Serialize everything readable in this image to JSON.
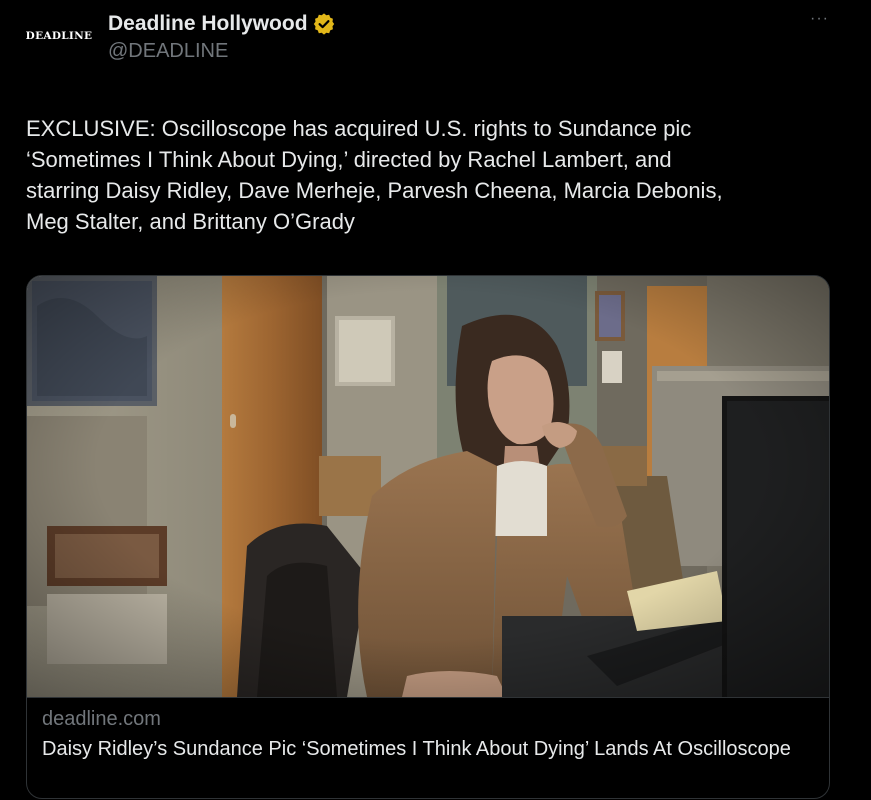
{
  "author": {
    "avatar_text": "DEADLINE",
    "display_name": "Deadline Hollywood",
    "handle": "@DEADLINE",
    "verified_color": "#e2b719"
  },
  "menu": {
    "more_label": "···"
  },
  "tweet": {
    "text": "EXCLUSIVE: Oscilloscope has acquired U.S. rights to Sundance pic\n‘Sometimes I Think About Dying,’ directed by Rachel Lambert, and\nstarring Daisy Ridley, Dave Merheje, Parvesh Cheena, Marcia Debonis,\nMeg Stalter, and Brittany O’Grady"
  },
  "card": {
    "domain": "deadline.com",
    "title": "Daisy Ridley’s Sundance Pic ‘Sometimes I Think About Dying’ Lands At Oscilloscope"
  }
}
